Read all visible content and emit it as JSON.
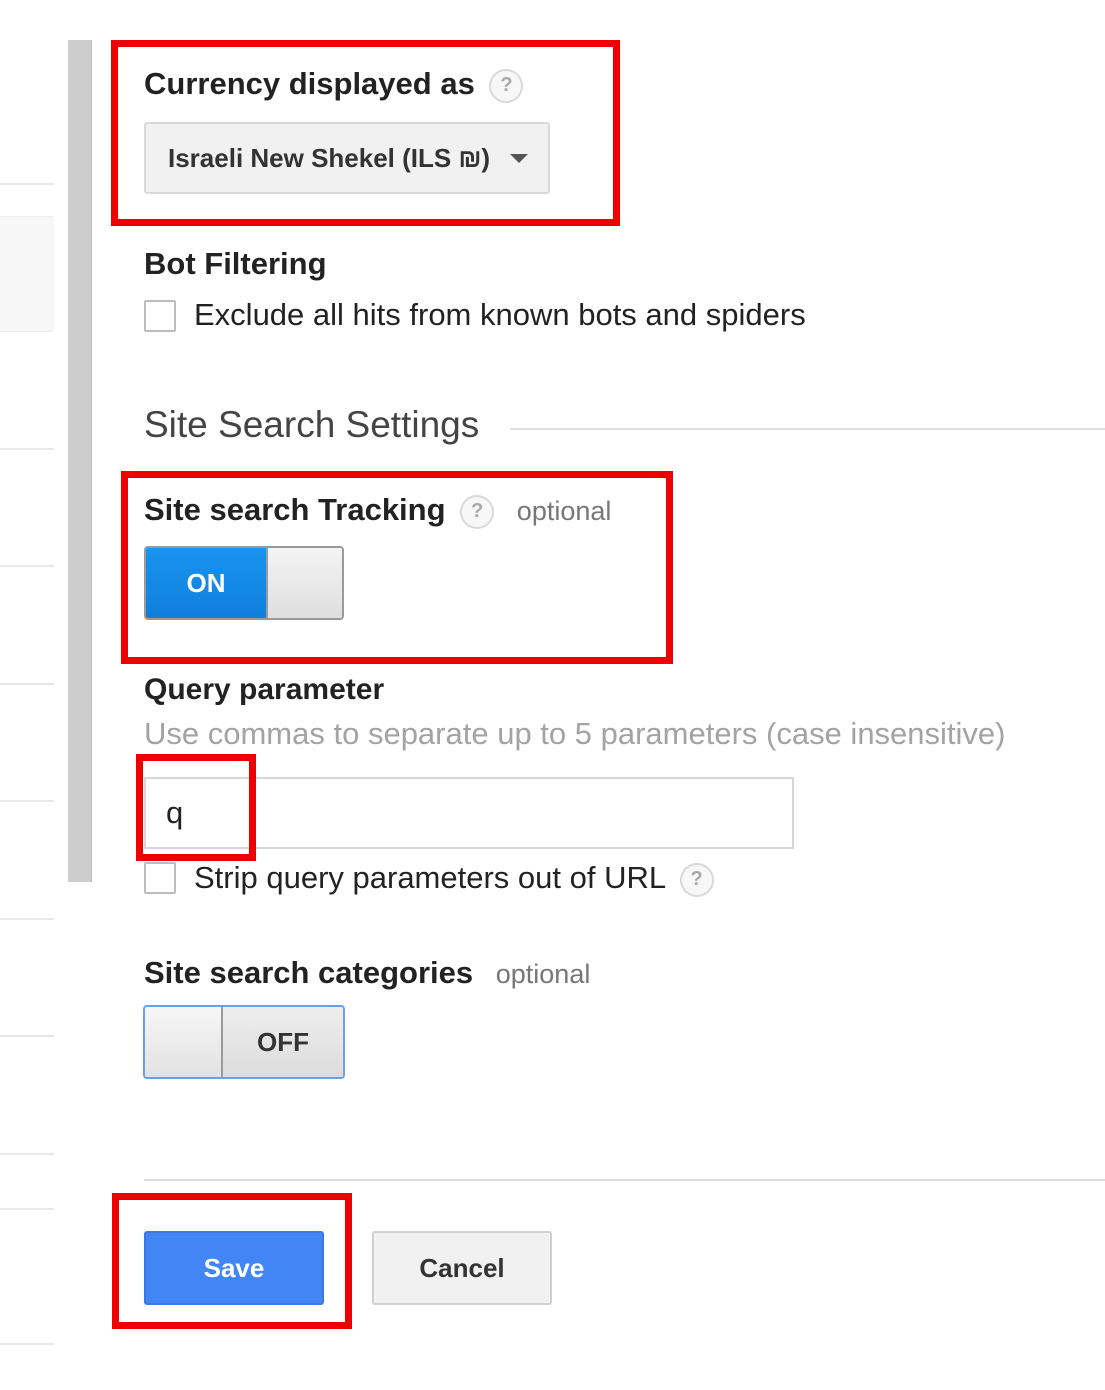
{
  "currency": {
    "label": "Currency displayed as",
    "help_icon": "?",
    "selected": "Israeli New Shekel (ILS ₪)"
  },
  "bot_filtering": {
    "label": "Bot Filtering",
    "checkbox_label": "Exclude all hits from known bots and spiders",
    "checked": false
  },
  "site_search_settings": {
    "title": "Site Search Settings"
  },
  "site_search_tracking": {
    "label": "Site search Tracking",
    "help_icon": "?",
    "optional": "optional",
    "toggle_state": "ON"
  },
  "query_parameter": {
    "label": "Query parameter",
    "hint": "Use commas to separate up to 5 parameters (case insensitive)",
    "value": "q",
    "strip_label": "Strip query parameters out of URL",
    "strip_checked": false,
    "help_icon": "?"
  },
  "site_search_categories": {
    "label": "Site search categories",
    "optional": "optional",
    "toggle_state": "OFF"
  },
  "actions": {
    "save": "Save",
    "cancel": "Cancel"
  },
  "colors": {
    "annotation": "#ee0000",
    "toggle_on": "#1a94ee",
    "save_button": "#4285f4"
  }
}
